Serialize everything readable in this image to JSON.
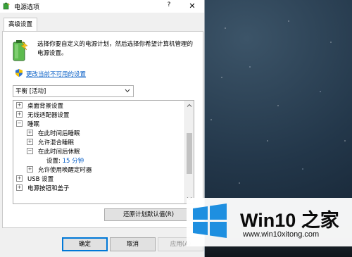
{
  "window": {
    "title": "电源选项",
    "help_label": "?",
    "close_label": "✕"
  },
  "tabs": [
    {
      "label": "高级设置"
    }
  ],
  "panel": {
    "description": "选择你要自定义的电源计划，然后选择你希望计算机管理的电源设置。",
    "change_link": "更改当前不可用的设置",
    "plan": {
      "selected": "平衡 [活动]"
    },
    "tree": [
      {
        "label": "桌面背景设置",
        "expander": "+"
      },
      {
        "label": "无线适配器设置",
        "expander": "+"
      },
      {
        "label": "睡眠",
        "expander": "−"
      },
      {
        "label": "在此时间后睡眠",
        "expander": "+"
      },
      {
        "label": "允许混合睡眠",
        "expander": "+"
      },
      {
        "label": "在此时间后休眠",
        "expander": "−"
      },
      {
        "label": "设置:",
        "value": "15 分钟"
      },
      {
        "label": "允许使用唤醒定时器",
        "expander": "+"
      },
      {
        "label": "USB 设置",
        "expander": "+"
      },
      {
        "label": "电源按钮和盖子",
        "expander": "+"
      }
    ],
    "restore_button": "还原计划默认值(R)"
  },
  "buttons": {
    "ok": "确定",
    "cancel": "取消",
    "apply": "应用(A)"
  },
  "watermark": {
    "brand": "Win10 之家",
    "url": "www.win10xitong.com"
  },
  "colors": {
    "link": "#0b61c7",
    "accent": "#0078d7",
    "win_logo": "#1e8fe0"
  },
  "icons": [
    "power-options-icon",
    "battery-icon",
    "uac-shield-icon",
    "chevron-down-icon",
    "windows-logo-icon"
  ]
}
